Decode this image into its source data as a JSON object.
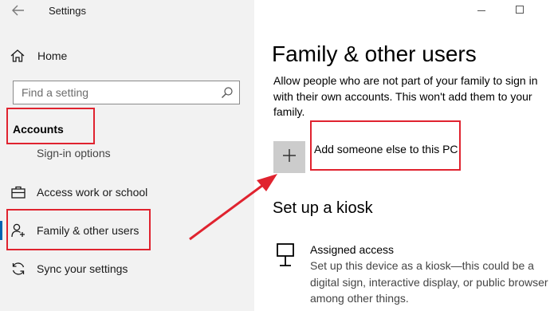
{
  "window": {
    "title": "Settings"
  },
  "sidebar": {
    "home_label": "Home",
    "search_placeholder": "Find a setting",
    "section_title": "Accounts",
    "items": [
      {
        "label": "Sign-in options",
        "icon": "key-icon"
      },
      {
        "label": "Access work or school",
        "icon": "briefcase-icon"
      },
      {
        "label": "Family & other users",
        "icon": "add-person-icon",
        "selected": true
      },
      {
        "label": "Sync your settings",
        "icon": "sync-icon"
      }
    ]
  },
  "main": {
    "title": "Family & other users",
    "description": "Allow people who are not part of your family to sign in with their own accounts. This won't add them to your family.",
    "add_label": "Add someone else to this PC",
    "kiosk_title": "Set up a kiosk",
    "assigned_access": {
      "title": "Assigned access",
      "description": "Set up this device as a kiosk—this could be a digital sign, interactive display, or public browser among other things."
    }
  },
  "colors": {
    "sidebar_bg": "#f2f2f2",
    "accent": "#0063b1",
    "annotation": "#e0232f",
    "add_button_bg": "#cccccc"
  }
}
